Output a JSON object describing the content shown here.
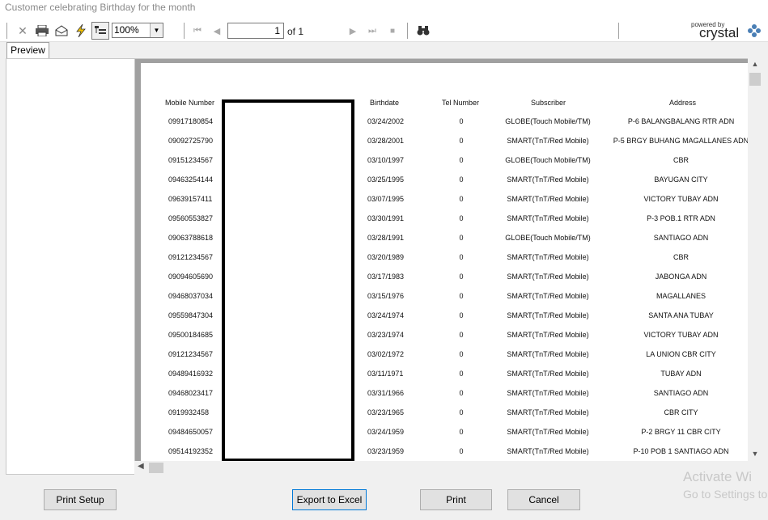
{
  "window": {
    "title": "Customer celebrating Birthday for the month"
  },
  "toolbar": {
    "zoom": "100%",
    "page_current": "1",
    "page_total": "of 1",
    "brand_small": "powered by",
    "brand": "crystal"
  },
  "tabs": [
    {
      "label": "Preview"
    }
  ],
  "report": {
    "columns": [
      "Mobile Number",
      "Birthdate",
      "Tel Number",
      "Subscriber",
      "Address"
    ],
    "rows": [
      [
        "09917180854",
        "03/24/2002",
        "0",
        "GLOBE(Touch Mobile/TM)",
        "P-6 BALANGBALANG RTR ADN"
      ],
      [
        "09092725790",
        "03/28/2001",
        "0",
        "SMART(TnT/Red Mobile)",
        "P-5 BRGY BUHANG MAGALLANES ADN"
      ],
      [
        "09151234567",
        "03/10/1997",
        "0",
        "GLOBE(Touch Mobile/TM)",
        "CBR"
      ],
      [
        "09463254144",
        "03/25/1995",
        "0",
        "SMART(TnT/Red Mobile)",
        "BAYUGAN CITY"
      ],
      [
        "09639157411",
        "03/07/1995",
        "0",
        "SMART(TnT/Red Mobile)",
        "VICTORY TUBAY ADN"
      ],
      [
        "09560553827",
        "03/30/1991",
        "0",
        "SMART(TnT/Red Mobile)",
        "P-3 POB.1 RTR ADN"
      ],
      [
        "09063788618",
        "03/28/1991",
        "0",
        "GLOBE(Touch Mobile/TM)",
        "SANTIAGO ADN"
      ],
      [
        "09121234567",
        "03/20/1989",
        "0",
        "SMART(TnT/Red Mobile)",
        "CBR"
      ],
      [
        "09094605690",
        "03/17/1983",
        "0",
        "SMART(TnT/Red Mobile)",
        "JABONGA ADN"
      ],
      [
        "09468037034",
        "03/15/1976",
        "0",
        "SMART(TnT/Red Mobile)",
        "MAGALLANES"
      ],
      [
        "09559847304",
        "03/24/1974",
        "0",
        "SMART(TnT/Red Mobile)",
        "SANTA ANA TUBAY"
      ],
      [
        "09500184685",
        "03/23/1974",
        "0",
        "SMART(TnT/Red Mobile)",
        "VICTORY TUBAY ADN"
      ],
      [
        "09121234567",
        "03/02/1972",
        "0",
        "SMART(TnT/Red Mobile)",
        "LA UNION CBR CITY"
      ],
      [
        "09489416932",
        "03/11/1971",
        "0",
        "SMART(TnT/Red Mobile)",
        "TUBAY ADN"
      ],
      [
        "09468023417",
        "03/31/1966",
        "0",
        "SMART(TnT/Red Mobile)",
        "SANTIAGO ADN"
      ],
      [
        "0919932458",
        "03/23/1965",
        "0",
        "SMART(TnT/Red Mobile)",
        "CBR CITY"
      ],
      [
        "09484650057",
        "03/24/1959",
        "0",
        "SMART(TnT/Red Mobile)",
        "P-2 BRGY 11 CBR CITY"
      ],
      [
        "09514192352",
        "03/23/1959",
        "0",
        "SMART(TnT/Red Mobile)",
        "P-10 POB 1 SANTIAGO ADN"
      ]
    ]
  },
  "buttons": {
    "print_setup": "Print Setup",
    "export": "Export to Excel",
    "print": "Print",
    "cancel": "Cancel"
  },
  "watermark": {
    "line1": "Activate Wi",
    "line2": "Go to Settings to"
  }
}
